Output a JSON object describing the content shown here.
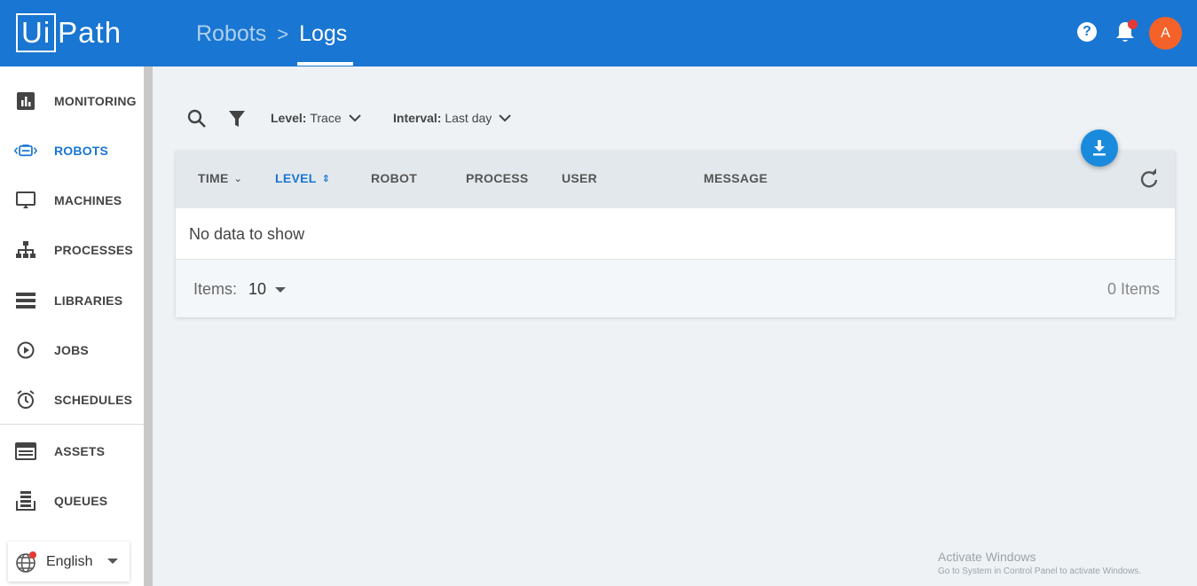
{
  "header": {
    "logo_boxed": "Ui",
    "logo_rest": "Path",
    "breadcrumb": {
      "parent": "Robots",
      "separator": ">",
      "current": "Logs"
    },
    "help_glyph": "?",
    "avatar_initial": "A",
    "accent_color": "#1976d2"
  },
  "sidebar": {
    "items": [
      {
        "label": "MONITORING",
        "icon": "monitoring-icon",
        "active": false
      },
      {
        "label": "ROBOTS",
        "icon": "robot-icon",
        "active": true
      },
      {
        "label": "MACHINES",
        "icon": "machine-icon",
        "active": false
      },
      {
        "label": "PROCESSES",
        "icon": "processes-icon",
        "active": false
      },
      {
        "label": "LIBRARIES",
        "icon": "libraries-icon",
        "active": false
      },
      {
        "label": "JOBS",
        "icon": "play-circle-icon",
        "active": false
      },
      {
        "label": "SCHEDULES",
        "icon": "alarm-clock-icon",
        "active": false
      },
      {
        "label": "ASSETS",
        "icon": "assets-icon",
        "active": false
      },
      {
        "label": "QUEUES",
        "icon": "queues-icon",
        "active": false
      }
    ],
    "language": {
      "label": "English",
      "icon": "globe-icon"
    }
  },
  "toolbar": {
    "level": {
      "label": "Level:",
      "value": "Trace"
    },
    "interval": {
      "label": "Interval:",
      "value": "Last day"
    }
  },
  "table": {
    "columns": [
      {
        "label": "TIME",
        "sort": "⌄"
      },
      {
        "label": "LEVEL",
        "sort": "⇕"
      },
      {
        "label": "ROBOT",
        "sort": ""
      },
      {
        "label": "PROCESS",
        "sort": ""
      },
      {
        "label": "USER",
        "sort": ""
      },
      {
        "label": "MESSAGE",
        "sort": ""
      }
    ],
    "empty_text": "No data to show",
    "footer": {
      "items_label": "Items:",
      "page_size": "10",
      "count_text": "0 Items"
    }
  },
  "watermark": {
    "title": "Activate Windows",
    "subtitle": "Go to System in Control Panel to activate Windows."
  }
}
